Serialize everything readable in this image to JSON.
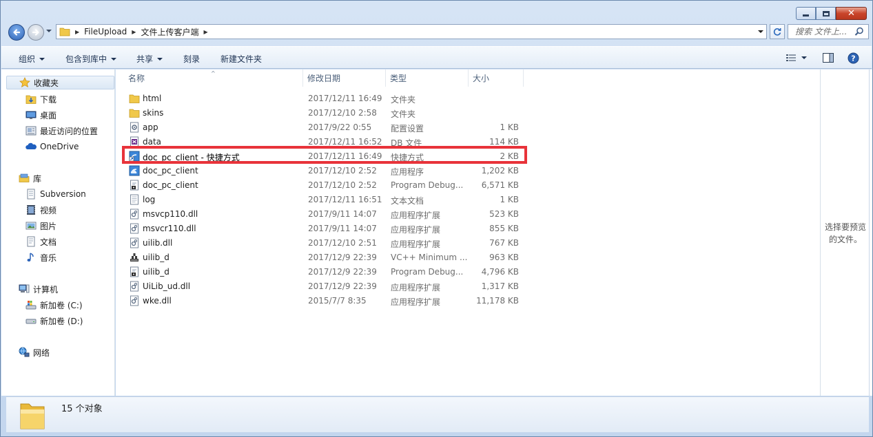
{
  "window": {
    "caption_close": "✕"
  },
  "address": {
    "crumbs": [
      "FileUpload",
      "文件上传客户端"
    ],
    "search_placeholder": "搜索 文件上..."
  },
  "toolbar": {
    "organize": "组织",
    "include_in_library": "包含到库中",
    "share": "共享",
    "burn": "刻录",
    "new_folder": "新建文件夹"
  },
  "nav": {
    "favorites": "收藏夹",
    "downloads": "下载",
    "desktop": "桌面",
    "recent": "最近访问的位置",
    "onedrive": "OneDrive",
    "libraries": "库",
    "subversion": "Subversion",
    "videos": "视频",
    "pictures": "图片",
    "documents": "文档",
    "music": "音乐",
    "computer": "计算机",
    "drive_c": "新加卷 (C:)",
    "drive_d": "新加卷 (D:)",
    "network": "网络"
  },
  "columns": {
    "name": "名称",
    "date": "修改日期",
    "type": "类型",
    "size": "大小"
  },
  "files": [
    {
      "name": "html",
      "date": "2017/12/11 16:49",
      "type": "文件夹",
      "size": "",
      "icon": "folder-icon"
    },
    {
      "name": "skins",
      "date": "2017/12/10 2:58",
      "type": "文件夹",
      "size": "",
      "icon": "folder-icon"
    },
    {
      "name": "app",
      "date": "2017/9/22 0:55",
      "type": "配置设置",
      "size": "1 KB",
      "icon": "config-file-icon"
    },
    {
      "name": "data",
      "date": "2017/12/11 16:52",
      "type": "DB 文件",
      "size": "114 KB",
      "icon": "db-file-icon"
    },
    {
      "name": "doc_pc_client - 快捷方式",
      "date": "2017/12/11 16:49",
      "type": "快捷方式",
      "size": "2 KB",
      "icon": "shortcut-icon"
    },
    {
      "name": "doc_pc_client",
      "date": "2017/12/10 2:52",
      "type": "应用程序",
      "size": "1,202 KB",
      "icon": "app-cloud-icon"
    },
    {
      "name": "doc_pc_client",
      "date": "2017/12/10 2:52",
      "type": "Program Debug...",
      "size": "6,571 KB",
      "icon": "pdb-file-icon"
    },
    {
      "name": "log",
      "date": "2017/12/11 16:51",
      "type": "文本文档",
      "size": "1 KB",
      "icon": "text-file-icon"
    },
    {
      "name": "msvcp110.dll",
      "date": "2017/9/11 14:07",
      "type": "应用程序扩展",
      "size": "523 KB",
      "icon": "dll-file-icon"
    },
    {
      "name": "msvcr110.dll",
      "date": "2017/9/11 14:07",
      "type": "应用程序扩展",
      "size": "855 KB",
      "icon": "dll-file-icon"
    },
    {
      "name": "uilib.dll",
      "date": "2017/12/10 2:51",
      "type": "应用程序扩展",
      "size": "767 KB",
      "icon": "dll-file-icon"
    },
    {
      "name": "uilib_d",
      "date": "2017/12/9 22:39",
      "type": "VC++ Minimum ...",
      "size": "963 KB",
      "icon": "vc-file-icon"
    },
    {
      "name": "uilib_d",
      "date": "2017/12/9 22:39",
      "type": "Program Debug...",
      "size": "4,796 KB",
      "icon": "pdb-file-icon"
    },
    {
      "name": "UiLib_ud.dll",
      "date": "2017/12/9 22:39",
      "type": "应用程序扩展",
      "size": "1,317 KB",
      "icon": "dll-file-icon"
    },
    {
      "name": "wke.dll",
      "date": "2015/7/7 8:35",
      "type": "应用程序扩展",
      "size": "11,178 KB",
      "icon": "dll-file-icon"
    }
  ],
  "preview": {
    "text": "选择要预览的文件。"
  },
  "status": {
    "count_text": "15 个对象"
  },
  "colors": {
    "highlight": "#e8333a",
    "folder": "#f0c84a"
  }
}
